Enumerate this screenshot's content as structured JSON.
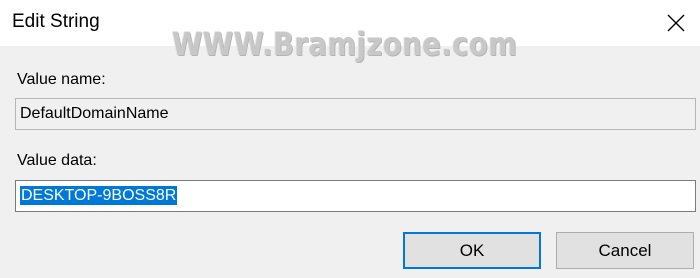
{
  "window": {
    "title": "Edit String",
    "watermark": "WWW.Bramjzone.com"
  },
  "value_name": {
    "label": "Value name:",
    "value": "DefaultDomainName"
  },
  "value_data": {
    "label": "Value data:",
    "value": "DESKTOP-9BOSS8R"
  },
  "buttons": {
    "ok": "OK",
    "cancel": "Cancel"
  },
  "colors": {
    "selection": "#0078d7",
    "dialog_bg": "#f0f0f0",
    "titlebar_bg": "#ffffff"
  },
  "icons": {
    "close": "close-icon"
  }
}
